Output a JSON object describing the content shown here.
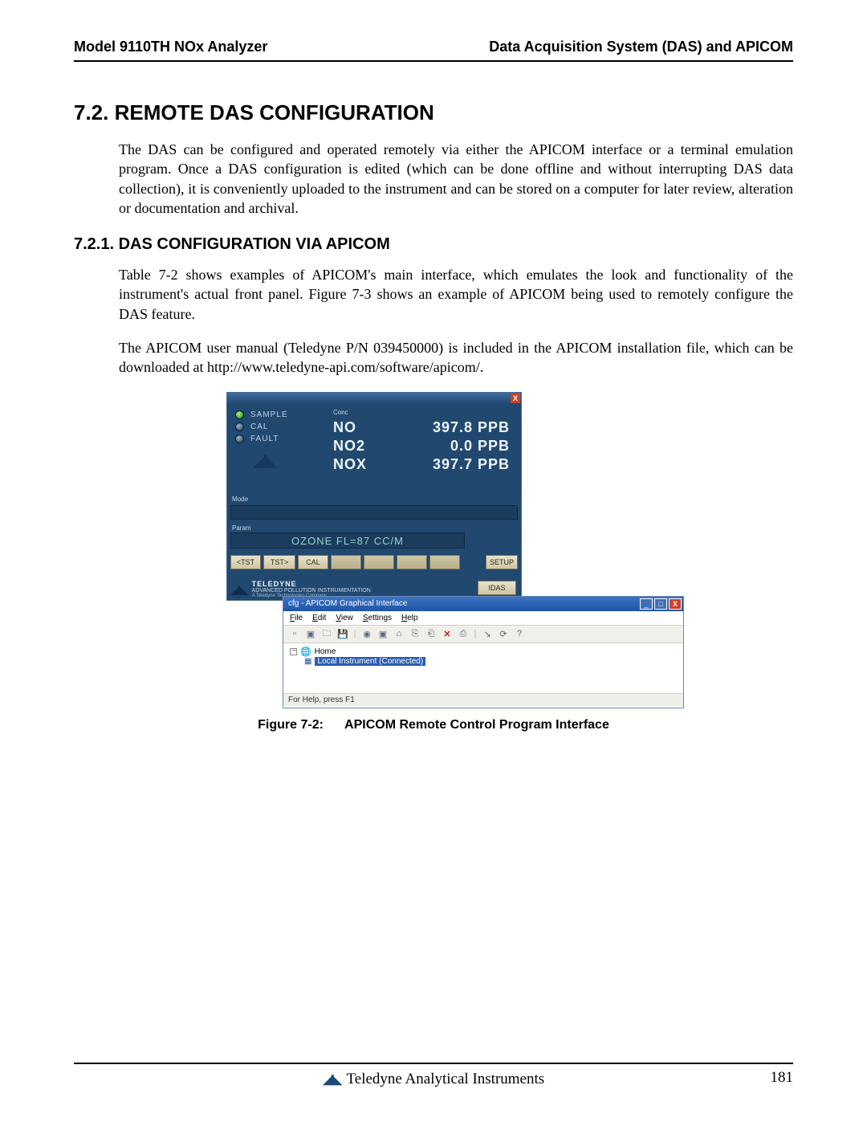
{
  "header": {
    "left": "Model 9110TH NOx Analyzer",
    "right": "Data Acquisition System (DAS) and APICOM"
  },
  "section": {
    "num_title": "7.2. REMOTE DAS CONFIGURATION",
    "para1": "The DAS can be configured and operated remotely via either the APICOM interface or a terminal emulation program. Once a DAS configuration is edited (which can be done offline and without interrupting DAS data collection), it is conveniently uploaded to the instrument and can be stored on a computer for later review, alteration or documentation and archival."
  },
  "subsection": {
    "num_title": "7.2.1. DAS CONFIGURATION VIA APICOM",
    "para1": "Table 7-2 shows examples of APICOM's main interface, which emulates the look and functionality of the instrument's actual front panel. Figure 7-3 shows an example of APICOM being used to remotely configure the DAS feature.",
    "para2": "The APICOM user manual (Teledyne P/N 039450000) is included in the APICOM installation file, which can be downloaded at http://www.teledyne-api.com/software/apicom/."
  },
  "instrument": {
    "close": "X",
    "leds": [
      {
        "label": "SAMPLE",
        "state": "green"
      },
      {
        "label": "CAL",
        "state": "off"
      },
      {
        "label": "FAULT",
        "state": "off"
      }
    ],
    "mode_label": "Mode",
    "conc_label": "Conc",
    "readings": [
      {
        "gas": "NO",
        "value": "397.8 PPB"
      },
      {
        "gas": "NO2",
        "value": "0.0 PPB"
      },
      {
        "gas": "NOX",
        "value": "397.7 PPB"
      }
    ],
    "param_label": "Param",
    "param_value": "OZONE FL=87 CC/M",
    "buttons": {
      "tst_prev": "<TST",
      "tst_next": "TST>",
      "cal": "CAL",
      "setup": "SETUP",
      "idas": "IDAS"
    },
    "brand": {
      "name": "TELEDYNE",
      "line2": "ADVANCED POLLUTION INSTRUMENTATION",
      "line3": "A Teledyne Technologies Company"
    }
  },
  "apicom": {
    "title": "cfg - APICOM Graphical Interface",
    "win_min": "_",
    "win_max": "□",
    "win_close": "X",
    "menu": {
      "file": "File",
      "edit": "Edit",
      "view": "View",
      "settings": "Settings",
      "help": "Help"
    },
    "tree": {
      "root": "Home",
      "child": "Local Instrument (Connected)"
    },
    "status": "For Help, press F1"
  },
  "figure_caption_label": "Figure 7-2:",
  "figure_caption_text": "APICOM Remote Control Program Interface",
  "footer": {
    "company": "Teledyne Analytical Instruments",
    "page": "181"
  }
}
